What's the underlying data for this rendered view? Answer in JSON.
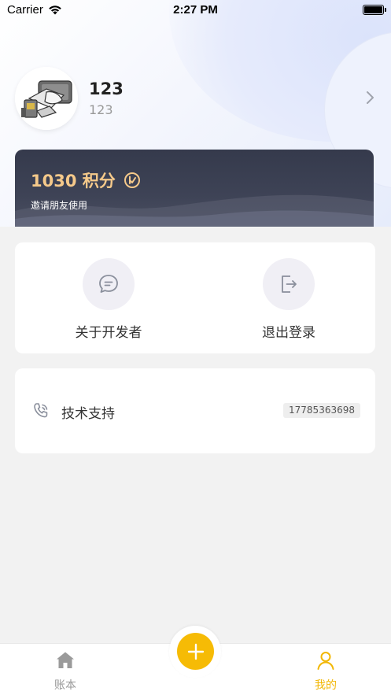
{
  "status_bar": {
    "carrier": "Carrier",
    "time": "2:27 PM"
  },
  "profile": {
    "name": "123",
    "id": "123"
  },
  "points": {
    "value": "1030 积分",
    "invite_text": "邀请朋友使用"
  },
  "actions": [
    {
      "label": "关于开发者",
      "icon": "chat-bubble-icon"
    },
    {
      "label": "退出登录",
      "icon": "logout-icon"
    }
  ],
  "support": {
    "label": "技术支持",
    "phone": "17785363698",
    "icon": "phone-icon"
  },
  "tabs": [
    {
      "label": "账本",
      "icon": "home-icon",
      "active": false
    },
    {
      "label": "我的",
      "icon": "person-icon",
      "active": true
    }
  ],
  "fab": {
    "icon": "plus-icon"
  },
  "colors": {
    "accent": "#f6bb05",
    "points_text": "#f5c98a",
    "card_dark": "#3a3f52"
  }
}
